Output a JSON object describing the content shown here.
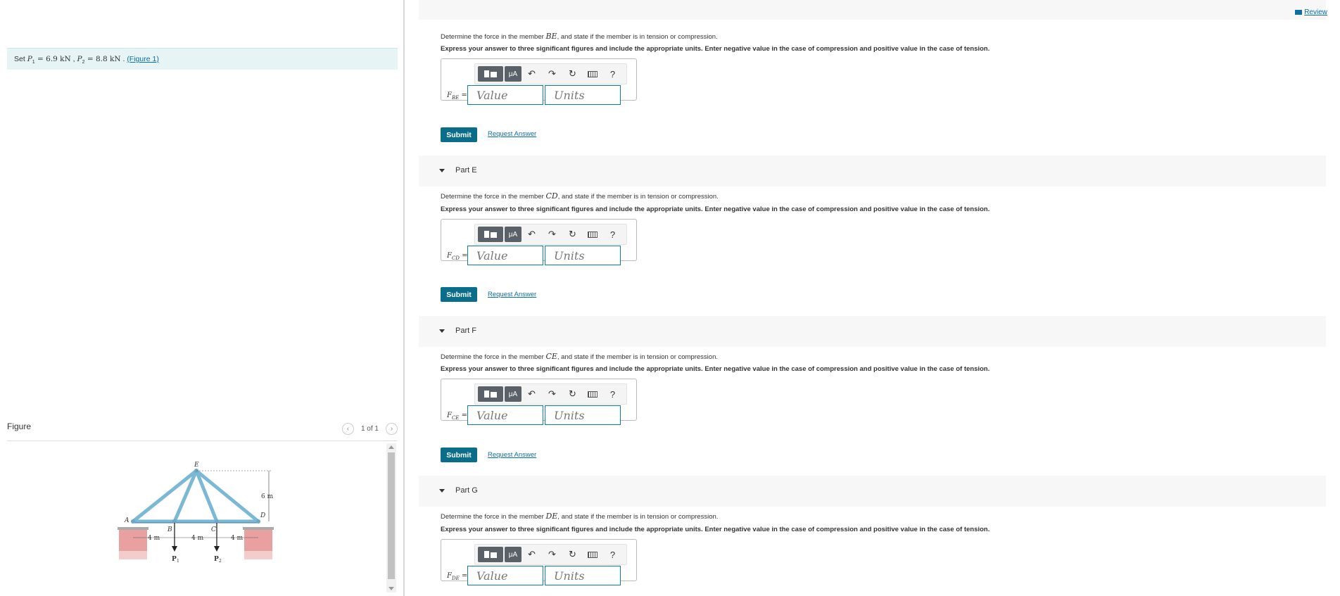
{
  "left": {
    "set_text": {
      "prefix": "Set ",
      "p1_sym": "P",
      "p1_sub": "1",
      "p1_val": " = 6.9  kN",
      "sep": " , ",
      "p2_sym": "P",
      "p2_sub": "2",
      "p2_val": " = 8.8  kN",
      "dot": " . ",
      "link": "(Figure 1)"
    },
    "figure_title": "Figure",
    "pager_text": "1 of 1",
    "figure_labels": {
      "E": "E",
      "A": "A",
      "B": "B",
      "C": "C",
      "D": "D",
      "h": "6 m",
      "w1": "4 m",
      "w2": "4 m",
      "w3": "4 m",
      "P1": "P",
      "P1sub": "1",
      "P2": "P",
      "P2sub": "2"
    }
  },
  "right": {
    "review": "Review",
    "toolbar": {
      "mu": "μA",
      "help": "?"
    },
    "instruction": "Express your answer to three significant figures and include the appropriate units. Enter negative value in the case of compression and positive value in the case of tension.",
    "value_placeholder": "Value",
    "units_placeholder": "Units",
    "submit": "Submit",
    "request": "Request Answer",
    "parts": [
      {
        "question_pre": "Determine the force in the member ",
        "member": "BE",
        "question_post": ", and state if the member is in tension or compression.",
        "flabel": "F",
        "fsub": "BE",
        "eq": " ="
      },
      {
        "label": "Part E",
        "question_pre": "Determine the force in the member ",
        "member": "CD",
        "question_post": ", and state if the member is in tension or compression.",
        "flabel": "F",
        "fsub": "CD",
        "eq": " ="
      },
      {
        "label": "Part F",
        "question_pre": "Determine the force in the member ",
        "member": "CE",
        "question_post": ", and state if the member is in tension or compression.",
        "flabel": "F",
        "fsub": "CE",
        "eq": " ="
      },
      {
        "label": "Part G",
        "question_pre": "Determine the force in the member ",
        "member": "DE",
        "question_post": ", and state if the member is in tension or compression.",
        "flabel": "F",
        "fsub": "DE",
        "eq": " ="
      }
    ]
  }
}
